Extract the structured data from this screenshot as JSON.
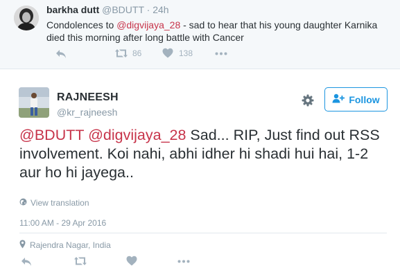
{
  "top_tweet": {
    "name": "barkha dutt",
    "handle": "@BDUTT",
    "separator": "·",
    "time": "24h",
    "text_before": "Condolences to ",
    "mention": "@digvijaya_28",
    "text_after": " - sad to hear that his young daughter Karnika died this morning after long battle with Cancer",
    "retweet_count": "86",
    "like_count": "138"
  },
  "main_tweet": {
    "name": "RAJNEESH",
    "handle": "@kr_rajneesh",
    "follow_label": "Follow",
    "mention_1": "@BDUTT",
    "mention_2": "@digvijaya_28",
    "text": " Sad... RIP, Just find out RSS involvement. Koi nahi, abhi idher hi shadi hui hai, 1-2 aur ho hi jayega..",
    "view_translation": "View translation",
    "timestamp": "11:00 AM - 29 Apr 2016",
    "location": "Rajendra Nagar, India"
  },
  "colors": {
    "mention": "#c7344a",
    "accent": "#1b95e0",
    "muted": "#8899a6",
    "icon": "#a3b2be"
  },
  "icons": [
    "reply-icon",
    "retweet-icon",
    "heart-icon",
    "more-icon",
    "gear-icon",
    "follow-person-icon",
    "globe-icon",
    "location-pin-icon"
  ]
}
